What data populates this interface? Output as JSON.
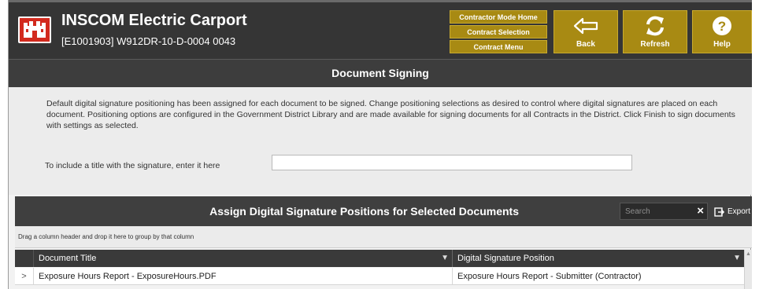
{
  "header": {
    "app_title": "INSCOM Electric Carport",
    "contract_line": "[E1001903] W912DR-10-D-0004  0043",
    "menu": [
      {
        "label": "Contractor Mode Home"
      },
      {
        "label": "Contract Selection"
      },
      {
        "label": "Contract Menu"
      }
    ],
    "tiles": {
      "back": {
        "label": "Back",
        "icon": "back-arrow-icon"
      },
      "refresh": {
        "label": "Refresh",
        "icon": "refresh-icon"
      },
      "help": {
        "label": "Help",
        "icon": "help-icon"
      }
    },
    "accent_color": "#a88a13"
  },
  "page": {
    "section_title": "Document Signing",
    "instructions": "Default digital signature positioning has been assigned for each document to be signed. Change positioning selections as desired to control where digital signatures are placed on each document. Positioning options are configured in the Government District Library and are made available for signing documents for all Contracts in the District. Click Finish to sign documents with settings as selected.",
    "title_label": "To include a title with the signature, enter it here",
    "title_value": ""
  },
  "grid": {
    "title": "Assign Digital Signature Positions for Selected Documents",
    "search_placeholder": "Search",
    "clear_glyph": "×",
    "export_label": "Export",
    "group_hint": "Drag a column header and drop it here to group by that column",
    "columns": [
      "Document Title",
      "Digital Signature Position"
    ],
    "rows": [
      {
        "expand": ">",
        "document_title": "Exposure Hours Report - ExposureHours.PDF",
        "signature_position": "Exposure Hours Report - Submitter (Contractor)"
      }
    ]
  }
}
